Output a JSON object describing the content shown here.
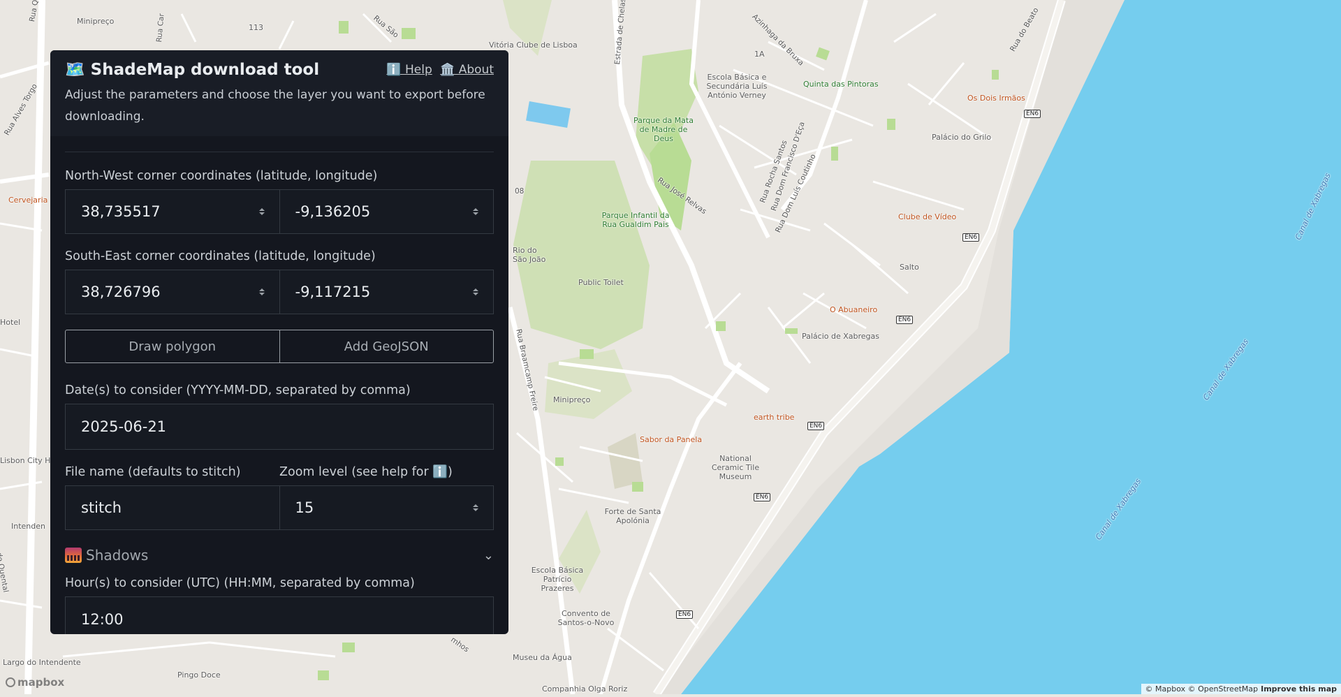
{
  "panel": {
    "title": "🗺️ ShadeMap download tool",
    "help_link": "ℹ️ Help",
    "about_link": "🏛️ About",
    "description": "Adjust the parameters and choose the layer you want to export before downloading.",
    "nw_label": "North-West corner coordinates (latitude, longitude)",
    "nw_lat": "38,735517",
    "nw_lon": "-9,136205",
    "se_label": "South-East corner coordinates (latitude, longitude)",
    "se_lat": "38,726796",
    "se_lon": "-9,117215",
    "draw_polygon": "Draw polygon",
    "add_geojson": "Add GeoJSON",
    "dates_label": "Date(s) to consider (YYYY-MM-DD, separated by comma)",
    "dates_value": "2025-06-21",
    "filename_label": "File name (defaults to stitch)",
    "filename_value": "stitch",
    "zoom_label": "Zoom level (see help for ℹ️)",
    "zoom_value": "15",
    "shadows_section": "Shadows",
    "hours_label": "Hour(s) to consider (UTC) (HH:MM, separated by comma)",
    "hours_value": "12:00"
  },
  "map": {
    "labels": {
      "minipreco_top": "Minipreço",
      "n113": "113",
      "rua_quirino": "Rua Quirino da",
      "rua_carlos": "Rua Car",
      "rua_sao": "Rua São",
      "rua_alves_torgo": "Rua Alves Torgo",
      "vitoria": "Vitória Clube de Lisboa",
      "estrada_chelas": "Estrada de Chelas",
      "azinhaga": "Azinhaga da Bruxa",
      "rua_do_beato": "Rua do Beato",
      "escola_verney": "Escola Básica e Secundária Luís António Verney",
      "one_a": "1A",
      "quinta_pintoras": "Quinta das Pintoras",
      "os_dois_irmaos": "Os Dois Irmãos",
      "parque_mata": "Parque da Mata de Madre de Deus",
      "palacio_grilo": "Palácio do Grilo",
      "rua_jose_relvas": "Rua José Relvas",
      "rua_rocha": "Rua Rocha Santos",
      "rua_dom_francisco": "Rua Dom Francisco D'Eça",
      "rua_dom_luis": "Rua Dom Luís Coutinho",
      "parque_infantil": "Parque Infantil da Rua Gualdim Pais",
      "clube_video": "Clube de Vídeo",
      "cervejaria": "Cervejaria",
      "rio_joao": "Rio do São João",
      "public_toilet": "Public Toilet",
      "salto": "Salto",
      "o_abuaneiro": "O Abuaneiro",
      "palacio_xabregas": "Palácio de Xabregas",
      "hotel": "Hotel",
      "rua_braamcamp": "Rua Braamcamp Freire",
      "minipreco_mid": "Minipreço",
      "earth_tribe": "earth tribe",
      "sabor_panela": "Sabor da Panela",
      "ceramic_museum": "National Ceramic Tile Museum",
      "lisbon_city": "Lisbon City H",
      "intendente": "Intenden",
      "forte_apolonia": "Forte de Santa Apolónia",
      "escola_prazeres": "Escola Básica Patrício Prazeres",
      "convento": "Convento de Santos-o-Novo",
      "museu_agua": "Museu da Água",
      "largo_intendente": "Largo do Intendente",
      "pingo_doce": "Pingo Doce",
      "olga_roriz": "Companhia Olga Roriz",
      "canal1": "Canal de Xabregas",
      "canal2": "Canal de Xabregas",
      "canal3": "Canal de Xabregas",
      "en6": "EN6",
      "n08": "08",
      "ruamos": "mhos",
      "quental": "de Quental"
    },
    "attribution": "© Mapbox © OpenStreetMap",
    "improve": "Improve this map",
    "logo": "mapbox"
  },
  "colors": {
    "panel_bg": "#14171f",
    "water": "#75cdee",
    "land": "#eae7e2",
    "park": "#cfe0b5"
  }
}
